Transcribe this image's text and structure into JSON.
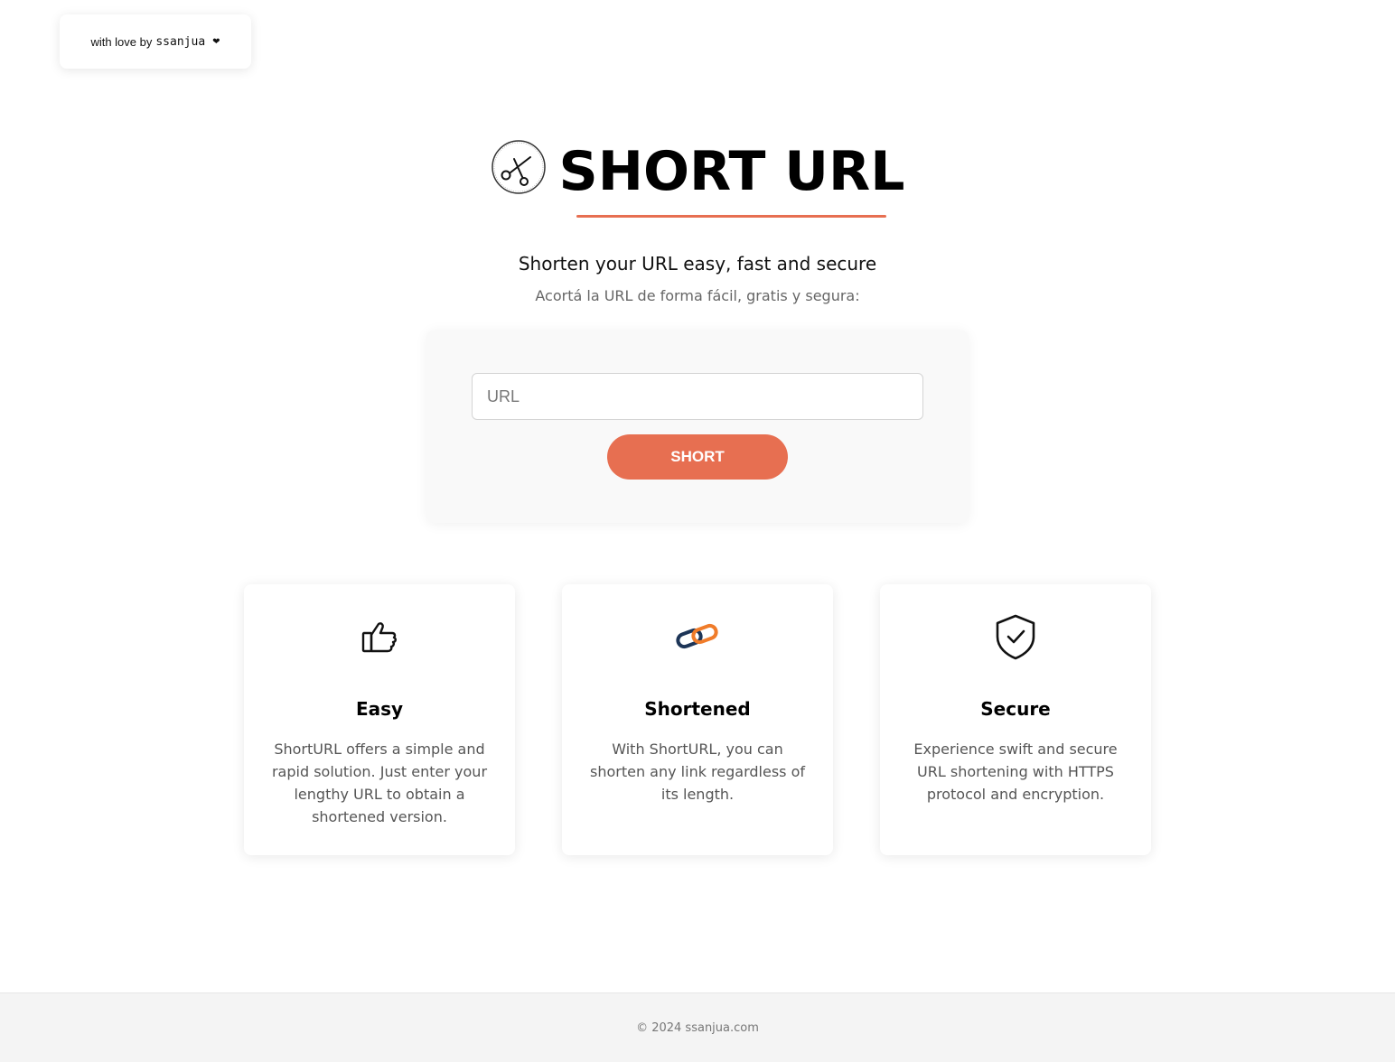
{
  "credit": {
    "prefix": "with love by",
    "author": "ssanjua",
    "heart": "❤"
  },
  "hero": {
    "title": "SHORT URL",
    "accent_color": "#e76f51"
  },
  "subtitle": "Shorten your URL easy, fast and secure",
  "subtitle_es": "Acortá la URL de forma fácil, gratis y segura:",
  "form": {
    "placeholder": "URL",
    "value": "",
    "button_label": "SHORT"
  },
  "features": [
    {
      "icon": "thumbs-up-icon",
      "title": "Easy",
      "text": "ShortURL offers a simple and rapid solution. Just enter your lengthy URL to obtain a shortened version."
    },
    {
      "icon": "chain-link-icon",
      "title": "Shortened",
      "text": "With ShortURL, you can shorten any link regardless of its length."
    },
    {
      "icon": "shield-check-icon",
      "title": "Secure",
      "text": "Experience swift and secure URL shortening with HTTPS protocol and encryption."
    }
  ],
  "footer": {
    "text": "© 2024 ssanjua.com"
  }
}
